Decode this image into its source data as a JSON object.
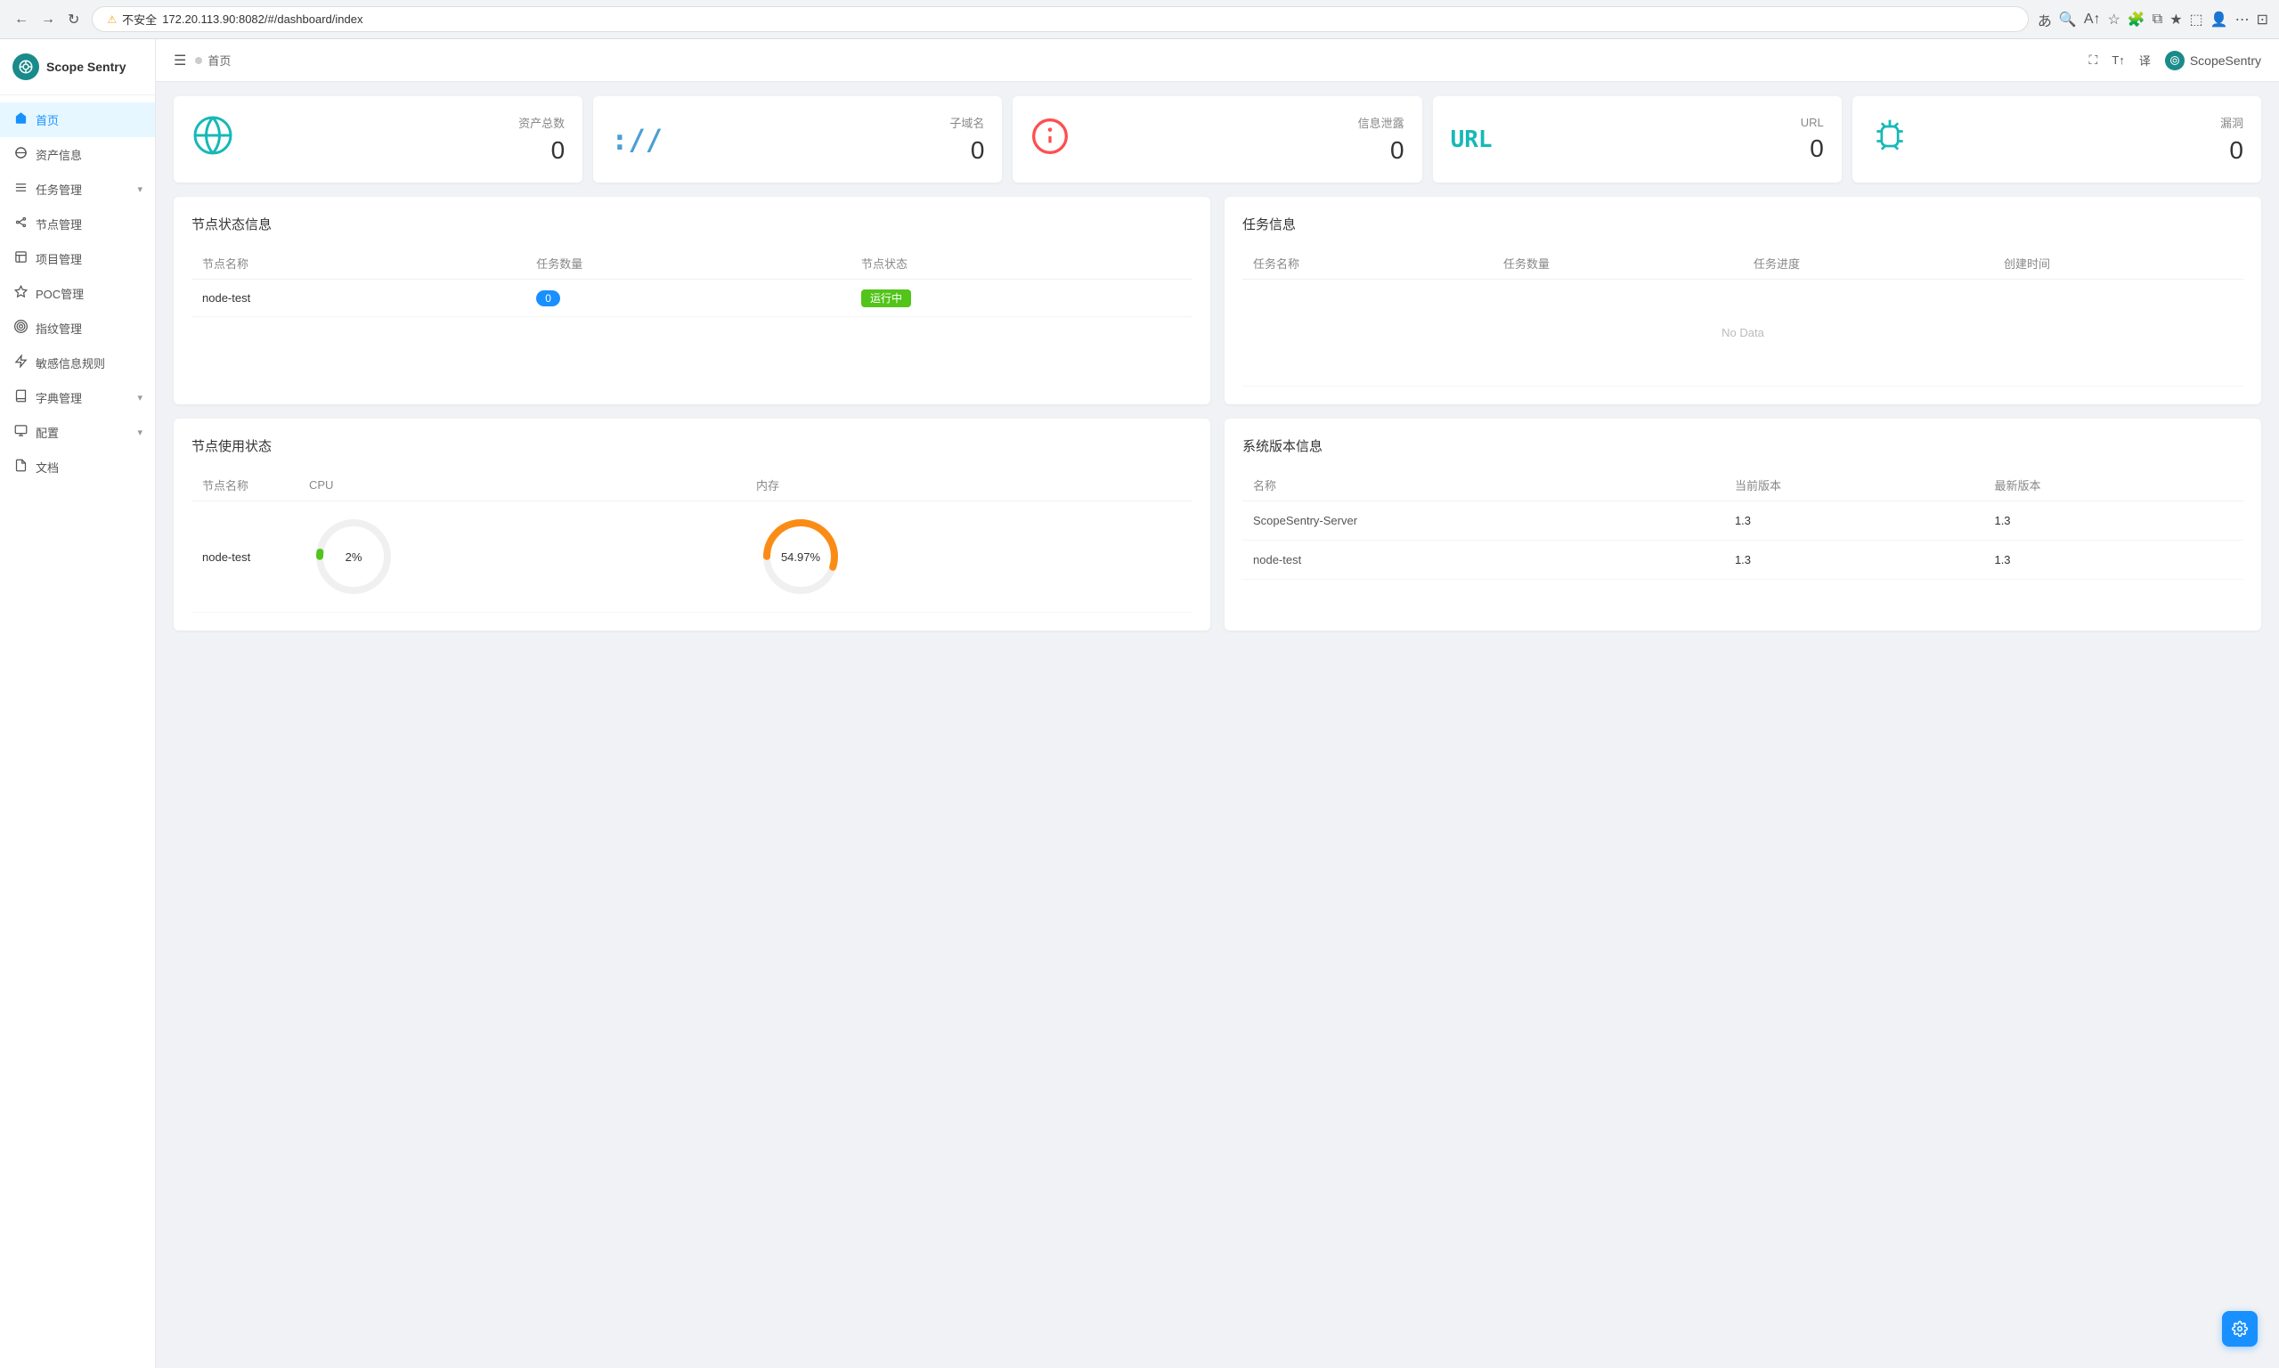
{
  "browser": {
    "url": "172.20.113.90:8082/#/dashboard/index",
    "warning_text": "不安全"
  },
  "app": {
    "logo_icon": "S",
    "logo_text": "Scope Sentry"
  },
  "sidebar": {
    "items": [
      {
        "id": "home",
        "label": "首页",
        "icon": "⊙",
        "active": true
      },
      {
        "id": "assets",
        "label": "资产信息",
        "icon": "○"
      },
      {
        "id": "tasks",
        "label": "任务管理",
        "icon": "≡",
        "has_arrow": true
      },
      {
        "id": "nodes",
        "label": "节点管理",
        "icon": "♟"
      },
      {
        "id": "projects",
        "label": "项目管理",
        "icon": "▣"
      },
      {
        "id": "poc",
        "label": "POC管理",
        "icon": "⚙"
      },
      {
        "id": "fingerprint",
        "label": "指纹管理",
        "icon": "◎"
      },
      {
        "id": "sensitive",
        "label": "敏感信息规则",
        "icon": "⚡"
      },
      {
        "id": "dictionary",
        "label": "字典管理",
        "icon": "📖",
        "has_arrow": true
      },
      {
        "id": "config",
        "label": "配置",
        "icon": "⚙",
        "has_arrow": true
      },
      {
        "id": "docs",
        "label": "文档",
        "icon": "📄"
      }
    ]
  },
  "topbar": {
    "breadcrumb": "首页",
    "brand_text": "ScopeSentry"
  },
  "stats": [
    {
      "id": "total-assets",
      "label": "资产总数",
      "value": "0",
      "icon": "globe"
    },
    {
      "id": "subdomains",
      "label": "子域名",
      "value": "0",
      "icon": "subdomain"
    },
    {
      "id": "info-leak",
      "label": "信息泄露",
      "value": "0",
      "icon": "info"
    },
    {
      "id": "url",
      "label": "URL",
      "value": "0",
      "icon": "url"
    },
    {
      "id": "vuln",
      "label": "漏洞",
      "value": "0",
      "icon": "bug"
    }
  ],
  "node_status": {
    "title": "节点状态信息",
    "columns": [
      "节点名称",
      "任务数量",
      "节点状态"
    ],
    "rows": [
      {
        "name": "node-test",
        "task_count": "0",
        "status": "运行中"
      }
    ]
  },
  "task_info": {
    "title": "任务信息",
    "columns": [
      "任务名称",
      "任务数量",
      "任务进度",
      "创建时间"
    ],
    "no_data": "No Data"
  },
  "node_usage": {
    "title": "节点使用状态",
    "columns": [
      "节点名称",
      "CPU",
      "内存"
    ],
    "rows": [
      {
        "name": "node-test",
        "cpu_percent": 2,
        "cpu_label": "2%",
        "mem_percent": 54.97,
        "mem_label": "54.97%"
      }
    ]
  },
  "system_version": {
    "title": "系统版本信息",
    "columns": [
      "名称",
      "当前版本",
      "最新版本"
    ],
    "rows": [
      {
        "name": "ScopeSentry-Server",
        "current": "1.3",
        "latest": "1.3"
      },
      {
        "name": "node-test",
        "current": "1.3",
        "latest": "1.3"
      }
    ]
  },
  "colors": {
    "primary": "#1890ff",
    "running": "#52c41a",
    "teal": "#17b8b8",
    "cpu_ring": "#52c41a",
    "mem_ring": "#fa8c16"
  }
}
